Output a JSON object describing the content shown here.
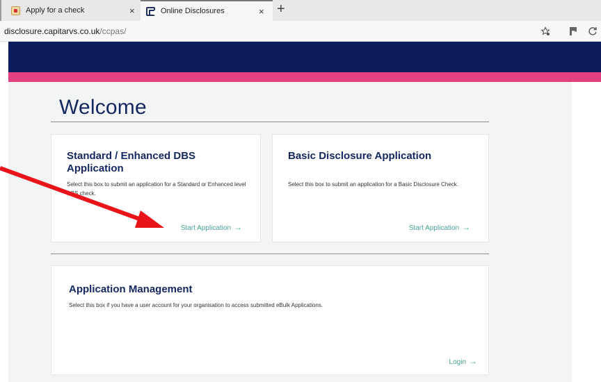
{
  "browser": {
    "tabs": [
      {
        "title": "Apply for a check",
        "icon": "house-favicon-icon"
      },
      {
        "title": "Online Disclosures",
        "icon": "capita-favicon-icon",
        "active": true
      }
    ],
    "new_tab_glyph": "+",
    "close_glyph": "×",
    "url_host": "disclosure.capitarvs.co.uk",
    "url_path": "/ccpas/",
    "toolbar_icons": [
      "favorite-star-icon",
      "collections-icon",
      "refresh-ext-icon"
    ]
  },
  "page": {
    "heading": "Welcome"
  },
  "cards": {
    "standard": {
      "title": "Standard / Enhanced DBS Application",
      "description": "Select this box to submit an application for a Standard or Enhanced level DBS check.",
      "link": "Start Application"
    },
    "basic": {
      "title": "Basic Disclosure Application",
      "description": "Select this box to submit an application for a Basic Disclosure Check.",
      "link": "Start Application"
    },
    "management": {
      "title": "Application Management",
      "description": "Select this box if you have a user account for your organisation to access submitted eBulk Applications.",
      "link": "Login"
    }
  },
  "arrow_glyph": "→",
  "colors": {
    "header_navy": "#0b1e5b",
    "accent_pink": "#e2407e",
    "link_teal": "#4aa295",
    "title_navy": "#14275f",
    "annotation_red": "#e8141a"
  }
}
